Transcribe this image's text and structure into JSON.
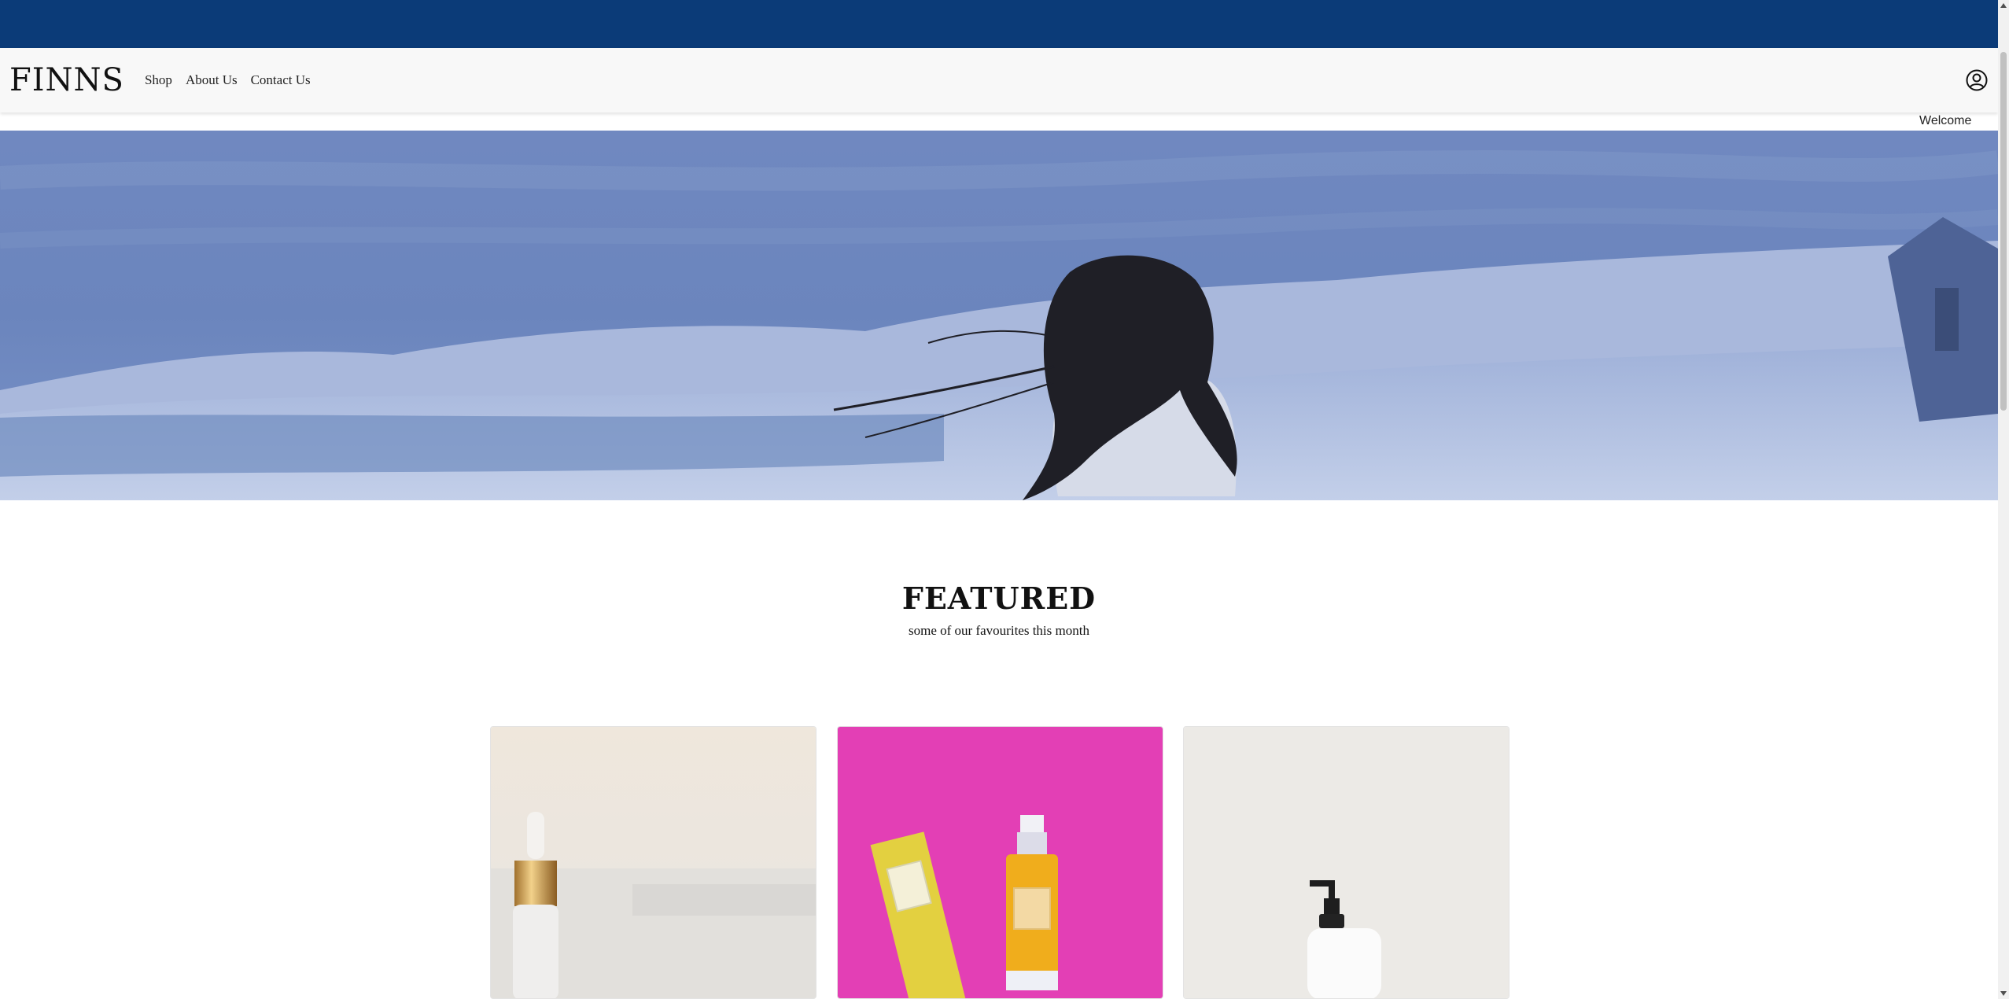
{
  "brand": {
    "logo": "FINNS"
  },
  "nav": {
    "links": [
      {
        "label": "Shop"
      },
      {
        "label": "About Us"
      },
      {
        "label": "Contact Us"
      }
    ],
    "account_icon": "user-circle-icon"
  },
  "header": {
    "welcome_text": "Welcome"
  },
  "hero": {
    "image": "snowy-landscape-woman-windblown-hair"
  },
  "featured": {
    "title": "FEATURED",
    "subtitle": "some of our favourites this month",
    "products": [
      {
        "image": "serum-dropper-bottle-on-beige"
      },
      {
        "image": "yellow-box-and-pump-bottle-on-pink"
      },
      {
        "image": "white-pump-lotion-bottle-on-grey"
      }
    ]
  },
  "colors": {
    "topbar": "#0b3b78",
    "navbar": "#f8f8f8",
    "hero_tint": "#6b86bd",
    "card_pink": "#e33fb5"
  }
}
